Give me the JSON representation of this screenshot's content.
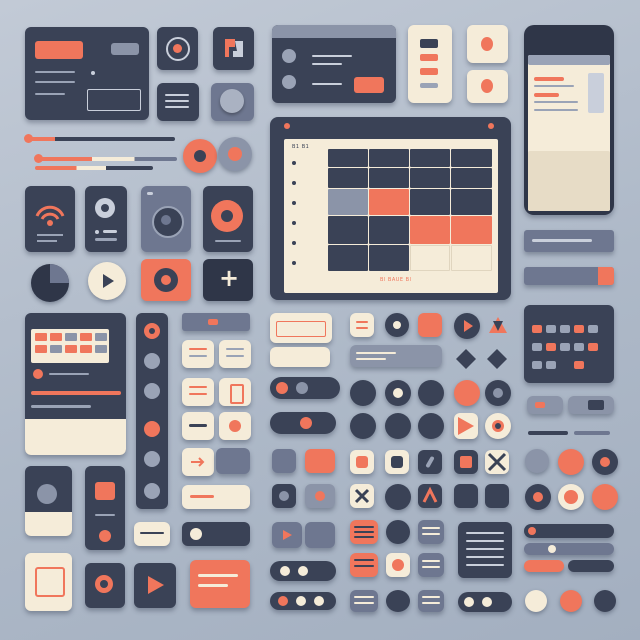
{
  "tablet": {
    "header_code": "B1 B1",
    "footer_text": "Bl BAUE Bl"
  },
  "icons": {
    "plus": "+",
    "play": "play-icon",
    "wifi": "wifi-icon",
    "target": "target-icon",
    "swap": "swap-icon"
  },
  "colors": {
    "dark": "#3a4256",
    "darker": "#2f3648",
    "cream": "#f5ecd9",
    "grey": "#6e7790",
    "coral": "#f0765c",
    "background": "#b4bfcd"
  }
}
